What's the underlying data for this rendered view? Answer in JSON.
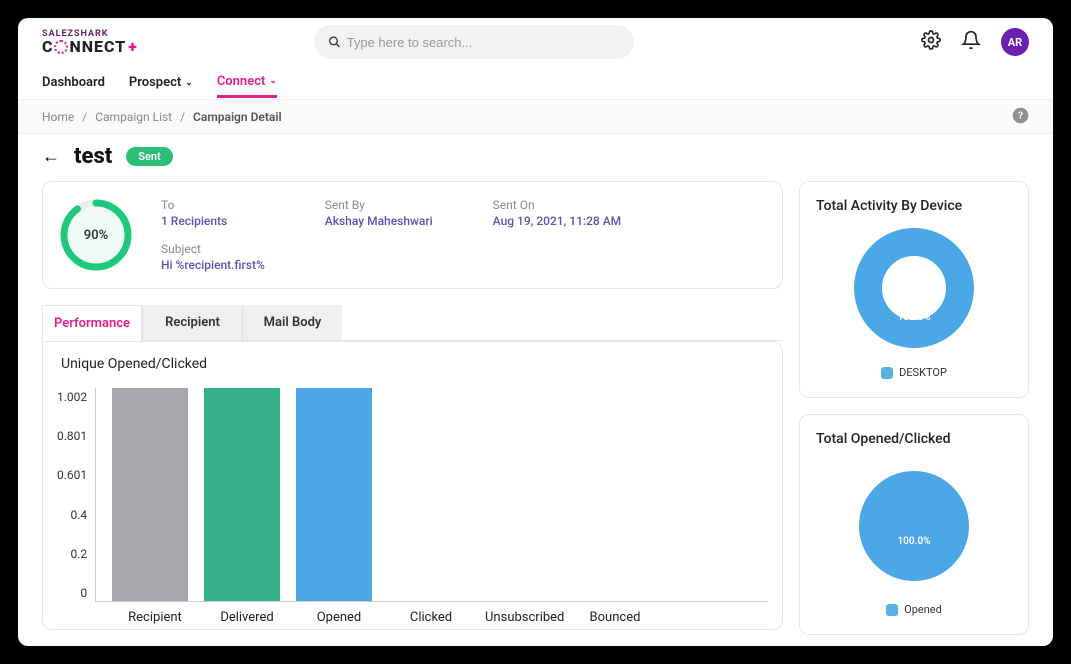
{
  "logo": {
    "top": "SALEZSHARK"
  },
  "search": {
    "placeholder": "Type here to search..."
  },
  "avatar": "AR",
  "nav": {
    "items": [
      {
        "label": "Dashboard",
        "caret": false
      },
      {
        "label": "Prospect",
        "caret": true
      },
      {
        "label": "Connect",
        "caret": true,
        "active": true
      }
    ]
  },
  "breadcrumb": {
    "home": "Home",
    "list": "Campaign List",
    "current": "Campaign Detail"
  },
  "title": {
    "name": "test",
    "status": "Sent"
  },
  "summary": {
    "ring_pct": 90,
    "ring_label": "90%",
    "to_label": "To",
    "to_value": "1 Recipients",
    "subject_label": "Subject",
    "subject_value": "Hi %recipient.first%",
    "sent_by_label": "Sent By",
    "sent_by_value": "Akshay Maheshwari",
    "sent_on_label": "Sent On",
    "sent_on_value": "Aug 19, 2021, 11:28 AM"
  },
  "tabs": [
    "Performance",
    "Recipient",
    "Mail Body"
  ],
  "active_tab": 0,
  "chart_title": "Unique Opened/Clicked",
  "chart_data": {
    "type": "bar",
    "categories": [
      "Recipient",
      "Delivered",
      "Opened",
      "Clicked",
      "Unsubscribed",
      "Bounced"
    ],
    "values": [
      1,
      1,
      1,
      0,
      0,
      0
    ],
    "colors": [
      "#a6a8ab",
      "#36b08a",
      "#4ca7e6",
      "#4ca7e6",
      "#4ca7e6",
      "#4ca7e6"
    ],
    "y_ticks": [
      "1.002",
      "0.801",
      "0.601",
      "0.4",
      "0.2",
      "0"
    ],
    "ylim": [
      0,
      1.002
    ],
    "xlabel": "",
    "ylabel": ""
  },
  "device_card": {
    "title": "Total Activity By Device",
    "pct_label": "100.0%",
    "legend": "DESKTOP",
    "color": "#4ca7e6"
  },
  "opened_card": {
    "title": "Total Opened/Clicked",
    "pct_label": "100.0%",
    "legend": "Opened",
    "color": "#4ca7e6"
  }
}
